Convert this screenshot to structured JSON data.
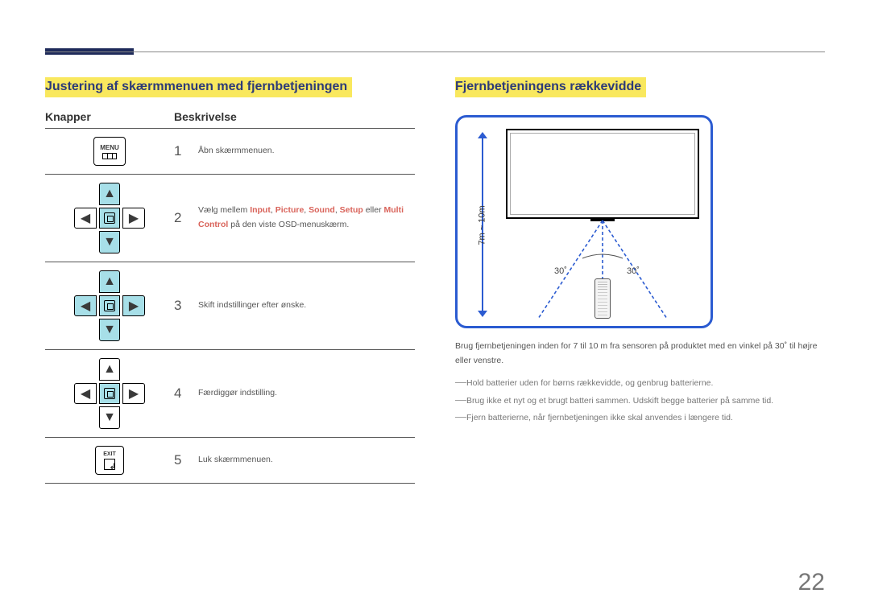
{
  "left": {
    "heading": "Justering af skærmmenuen med fjernbetjeningen",
    "col_buttons": "Knapper",
    "col_desc": "Beskrivelse",
    "menu_label": "MENU",
    "exit_label": "EXIT",
    "rows": [
      {
        "num": "1",
        "desc_plain": "Åbn skærmmenuen."
      },
      {
        "num": "2",
        "desc_before": "Vælg mellem ",
        "kw1": "Input",
        "kw2": "Picture",
        "kw3": "Sound",
        "kw4": "Setup",
        "mid": " eller ",
        "kw5": "Multi Control",
        "desc_after": " på den viste OSD-menuskærm."
      },
      {
        "num": "3",
        "desc_plain": "Skift indstillinger efter ønske."
      },
      {
        "num": "4",
        "desc_plain": "Færdiggør indstilling."
      },
      {
        "num": "5",
        "desc_plain": "Luk skærmmenuen."
      }
    ]
  },
  "right": {
    "heading": "Fjernbetjeningens rækkevidde",
    "distance_label": "7m ~ 10m",
    "angle_left": "30˚",
    "angle_right": "30˚",
    "paragraph": "Brug fjernbetjeningen inden for 7 til 10 m fra sensoren på produktet med en vinkel på 30˚ til højre eller venstre.",
    "notes": [
      "Hold batterier uden for børns rækkevidde, og genbrug batterierne.",
      "Brug ikke et nyt og et brugt batteri sammen. Udskift begge batterier på samme tid.",
      "Fjern batterierne, når fjernbetjeningen ikke skal anvendes i længere tid."
    ]
  },
  "page_number": "22"
}
